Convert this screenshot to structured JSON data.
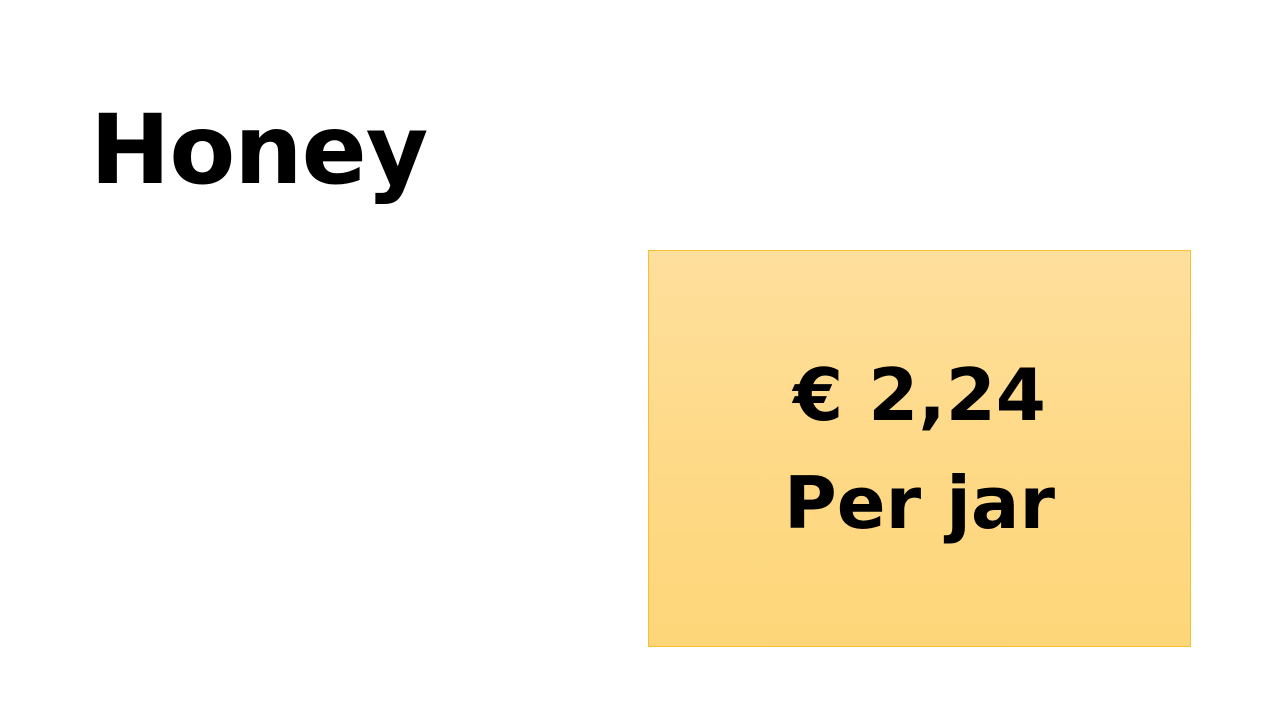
{
  "slide": {
    "title": "Honey",
    "price": {
      "amount_line": "€ 2,24",
      "unit_line": "Per jar"
    }
  },
  "colors": {
    "background": "#ffffff",
    "box_fill_top": "#fedf9c",
    "box_fill_bottom": "#fed679",
    "box_border": "#f2c232",
    "text": "#000000"
  }
}
